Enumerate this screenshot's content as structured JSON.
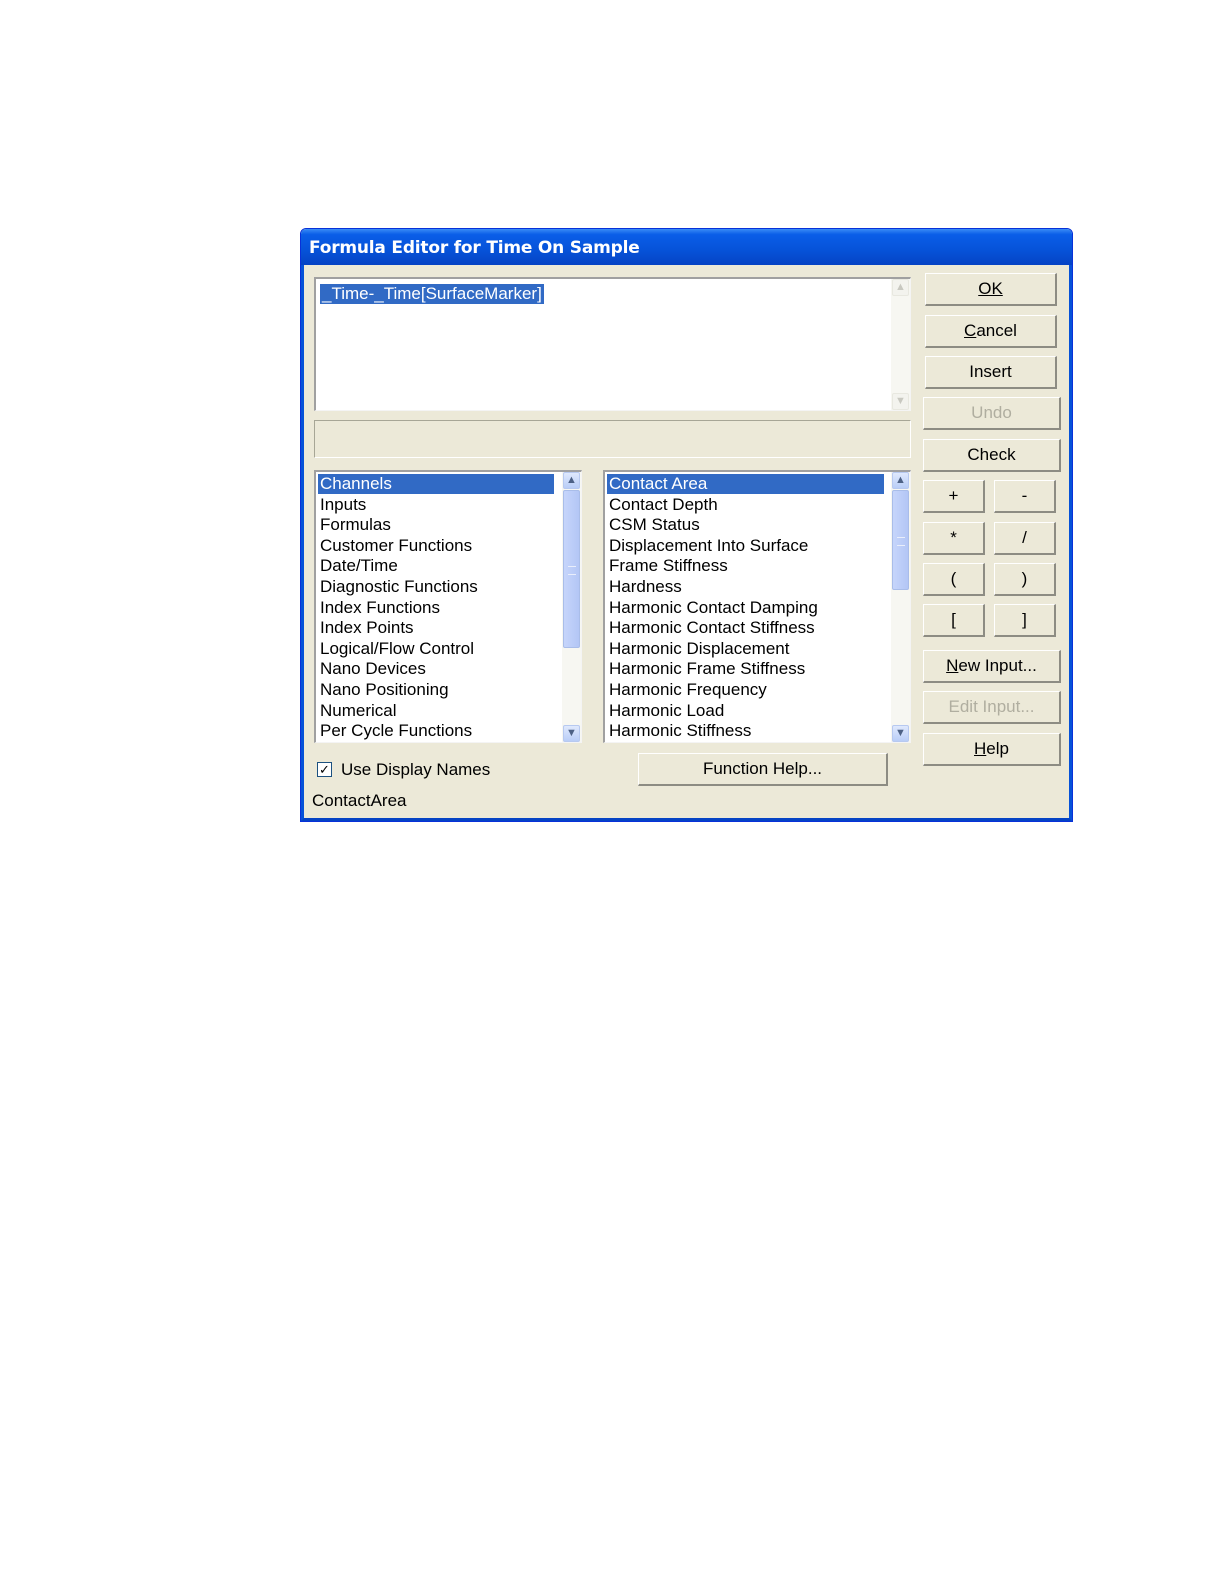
{
  "window": {
    "title": "Formula Editor for Time On Sample"
  },
  "formula": {
    "text": "_Time-_Time[SurfaceMarker]"
  },
  "status_message": "",
  "categories": {
    "items": [
      "Channels",
      "Inputs",
      "Formulas",
      "Customer Functions",
      "Date/Time",
      "Diagnostic Functions",
      "Index Functions",
      "Index Points",
      "Logical/Flow Control",
      "Nano Devices",
      "Nano Positioning",
      "Numerical",
      "Per Cycle Functions"
    ],
    "selected": "Channels"
  },
  "channels": {
    "items": [
      "Contact Area",
      "Contact Depth",
      "CSM Status",
      "Displacement Into Surface",
      "Frame Stiffness",
      "Hardness",
      "Harmonic Contact Damping",
      "Harmonic Contact Stiffness",
      "Harmonic Displacement",
      "Harmonic Frame Stiffness",
      "Harmonic Frequency",
      "Harmonic Load",
      "Harmonic Stiffness"
    ],
    "selected": "Contact Area"
  },
  "buttons": {
    "ok": {
      "label": "OK",
      "mnemonic": "O"
    },
    "cancel": {
      "label": "Cancel",
      "mnemonic": "C"
    },
    "insert": {
      "label": "Insert"
    },
    "undo": {
      "label": "Undo",
      "enabled": false
    },
    "check": {
      "label": "Check"
    },
    "plus": "+",
    "minus": "-",
    "multiply": "*",
    "divide": "/",
    "open_paren": "(",
    "close_paren": ")",
    "open_bracket": "[",
    "close_bracket": "]",
    "new_input": {
      "label": "New Input...",
      "mnemonic": "N"
    },
    "edit_input": {
      "label": "Edit Input...",
      "enabled": false
    },
    "help": {
      "label": "Help",
      "mnemonic": "H"
    },
    "function_help": {
      "label": "Function Help..."
    }
  },
  "use_display_names": {
    "label": "Use Display Names",
    "checked": true
  },
  "status_bar": {
    "text": "ContactArea"
  },
  "colors": {
    "title_bar": "#0652d8",
    "selection": "#316ac5",
    "dialog_bg": "#ece9d8"
  },
  "icons": {
    "scroll_up": "chevron-up-icon",
    "scroll_down": "chevron-down-icon",
    "checkmark": "checkmark-icon"
  }
}
